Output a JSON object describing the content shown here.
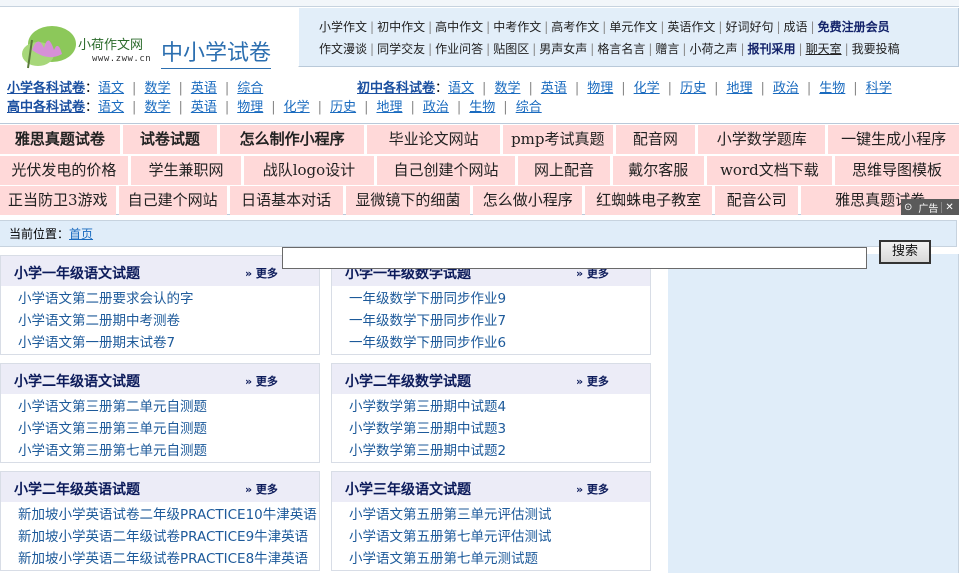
{
  "header": {
    "logo_brand": "小荷作文网",
    "logo_url": "www.zww.cn",
    "site_title": "中小学试卷",
    "nav_row1": [
      {
        "label": "小学作文"
      },
      {
        "label": "初中作文"
      },
      {
        "label": "高中作文"
      },
      {
        "label": "中考作文"
      },
      {
        "label": "高考作文"
      },
      {
        "label": "单元作文"
      },
      {
        "label": "英语作文"
      },
      {
        "label": "好词好句"
      },
      {
        "label": "成语"
      },
      {
        "label": "免费注册会员",
        "bold": true
      }
    ],
    "nav_row2": [
      {
        "label": "作文漫谈"
      },
      {
        "label": "同学交友"
      },
      {
        "label": "作业问答"
      },
      {
        "label": "贴图区"
      },
      {
        "label": "男声女声"
      },
      {
        "label": "格言名言"
      },
      {
        "label": "赠言"
      },
      {
        "label": "小荷之声"
      },
      {
        "label": "报刊采用",
        "bold": true
      },
      {
        "label": "聊天室",
        "underline": true
      },
      {
        "label": "我要投稿"
      }
    ]
  },
  "subjects": {
    "primary": {
      "label": "小学各科试卷",
      "items": [
        "语文",
        "数学",
        "英语",
        "综合"
      ]
    },
    "junior": {
      "label": "初中各科试卷",
      "items": [
        "语文",
        "数学",
        "英语",
        "物理",
        "化学",
        "历史",
        "地理",
        "政治",
        "生物",
        "科学"
      ]
    },
    "senior": {
      "label": "高中各科试卷",
      "items": [
        "语文",
        "数学",
        "英语",
        "物理",
        "化学",
        "历史",
        "地理",
        "政治",
        "生物",
        "综合"
      ]
    }
  },
  "tags": {
    "row1": [
      {
        "label": "雅思真题试卷",
        "bold": true
      },
      {
        "label": "试卷试题",
        "bold": true
      },
      {
        "label": "怎么制作小程序",
        "bold": true
      },
      {
        "label": "毕业论文网站"
      },
      {
        "label": "pmp考试真题"
      },
      {
        "label": "配音网"
      },
      {
        "label": "小学数学题库"
      },
      {
        "label": "一键生成小程序"
      }
    ],
    "row2": [
      {
        "label": "光伏发电的价格"
      },
      {
        "label": "学生兼职网"
      },
      {
        "label": "战队logo设计"
      },
      {
        "label": "自己创建个网站"
      },
      {
        "label": "网上配音"
      },
      {
        "label": "戴尔客服"
      },
      {
        "label": "word文档下载"
      },
      {
        "label": "思维导图模板"
      }
    ],
    "row3": [
      {
        "label": "正当防卫3游戏"
      },
      {
        "label": "自己建个网站"
      },
      {
        "label": "日语基本对话"
      },
      {
        "label": "显微镜下的细菌"
      },
      {
        "label": "怎么做小程序"
      },
      {
        "label": "红蜘蛛电子教室"
      },
      {
        "label": "配音公司"
      },
      {
        "label": "雅思真题试卷"
      }
    ],
    "ad_label": "广告",
    "ad_close": "✕"
  },
  "breadcrumb": {
    "prefix": "当前位置：",
    "home": "首页"
  },
  "search": {
    "placeholder": "",
    "value": "",
    "button": "搜索"
  },
  "boxes": [
    {
      "title": "小学一年级语文试题",
      "more": "» 更多",
      "items": [
        "小学语文第二册要求会认的字",
        "小学语文第二册期中考测卷",
        "小学语文第一册期末试卷7"
      ]
    },
    {
      "title": "小学一年级数学试题",
      "more": "» 更多",
      "items": [
        "一年级数学下册同步作业9",
        "一年级数学下册同步作业7",
        "一年级数学下册同步作业6"
      ]
    },
    {
      "title": "小学二年级语文试题",
      "more": "» 更多",
      "items": [
        "小学语文第三册第二单元自测题",
        "小学语文第三册第三单元自测题",
        "小学语文第三册第七单元自测题"
      ]
    },
    {
      "title": "小学二年级数学试题",
      "more": "» 更多",
      "items": [
        "小学数学第三册期中试题4",
        "小学数学第三册期中试题3",
        "小学数学第三册期中试题2"
      ]
    },
    {
      "title": "小学二年级英语试题",
      "more": "» 更多",
      "items": [
        "新加坡小学英语试卷二年级PRACTICE10牛津英语",
        "新加坡小学英语二年级试卷PRACTICE9牛津英语",
        "新加坡小学英语二年级试卷PRACTICE8牛津英语"
      ]
    },
    {
      "title": "小学三年级语文试题",
      "more": "» 更多",
      "items": [
        "小学语文第五册第三单元评估测试",
        "小学语文第五册第七单元评估测试",
        "小学语文第五册第七单元测试题"
      ]
    }
  ]
}
